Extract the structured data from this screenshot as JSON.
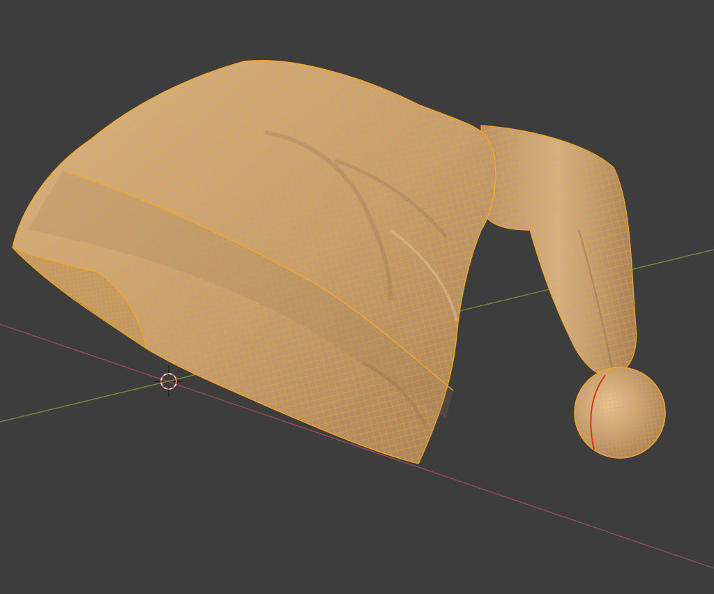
{
  "viewport": {
    "background": "#3d3d3d",
    "object": "santa-hat-mesh",
    "display_mode": "solid-with-wireframe-overlay",
    "selected": true
  },
  "colors": {
    "mesh_surface": "#cfa77a",
    "mesh_surface_light": "#e4c29a",
    "mesh_surface_dark": "#9c7854",
    "wireframe_selected": "#f5a623",
    "seam": "#d43a1a",
    "x_axis": "#9a4a5a",
    "y_axis": "#6b8f3d",
    "cursor_ring": "#e8e8e8",
    "cursor_dash": "#d9553a"
  },
  "icons": {
    "cursor": "3d-cursor-icon"
  }
}
